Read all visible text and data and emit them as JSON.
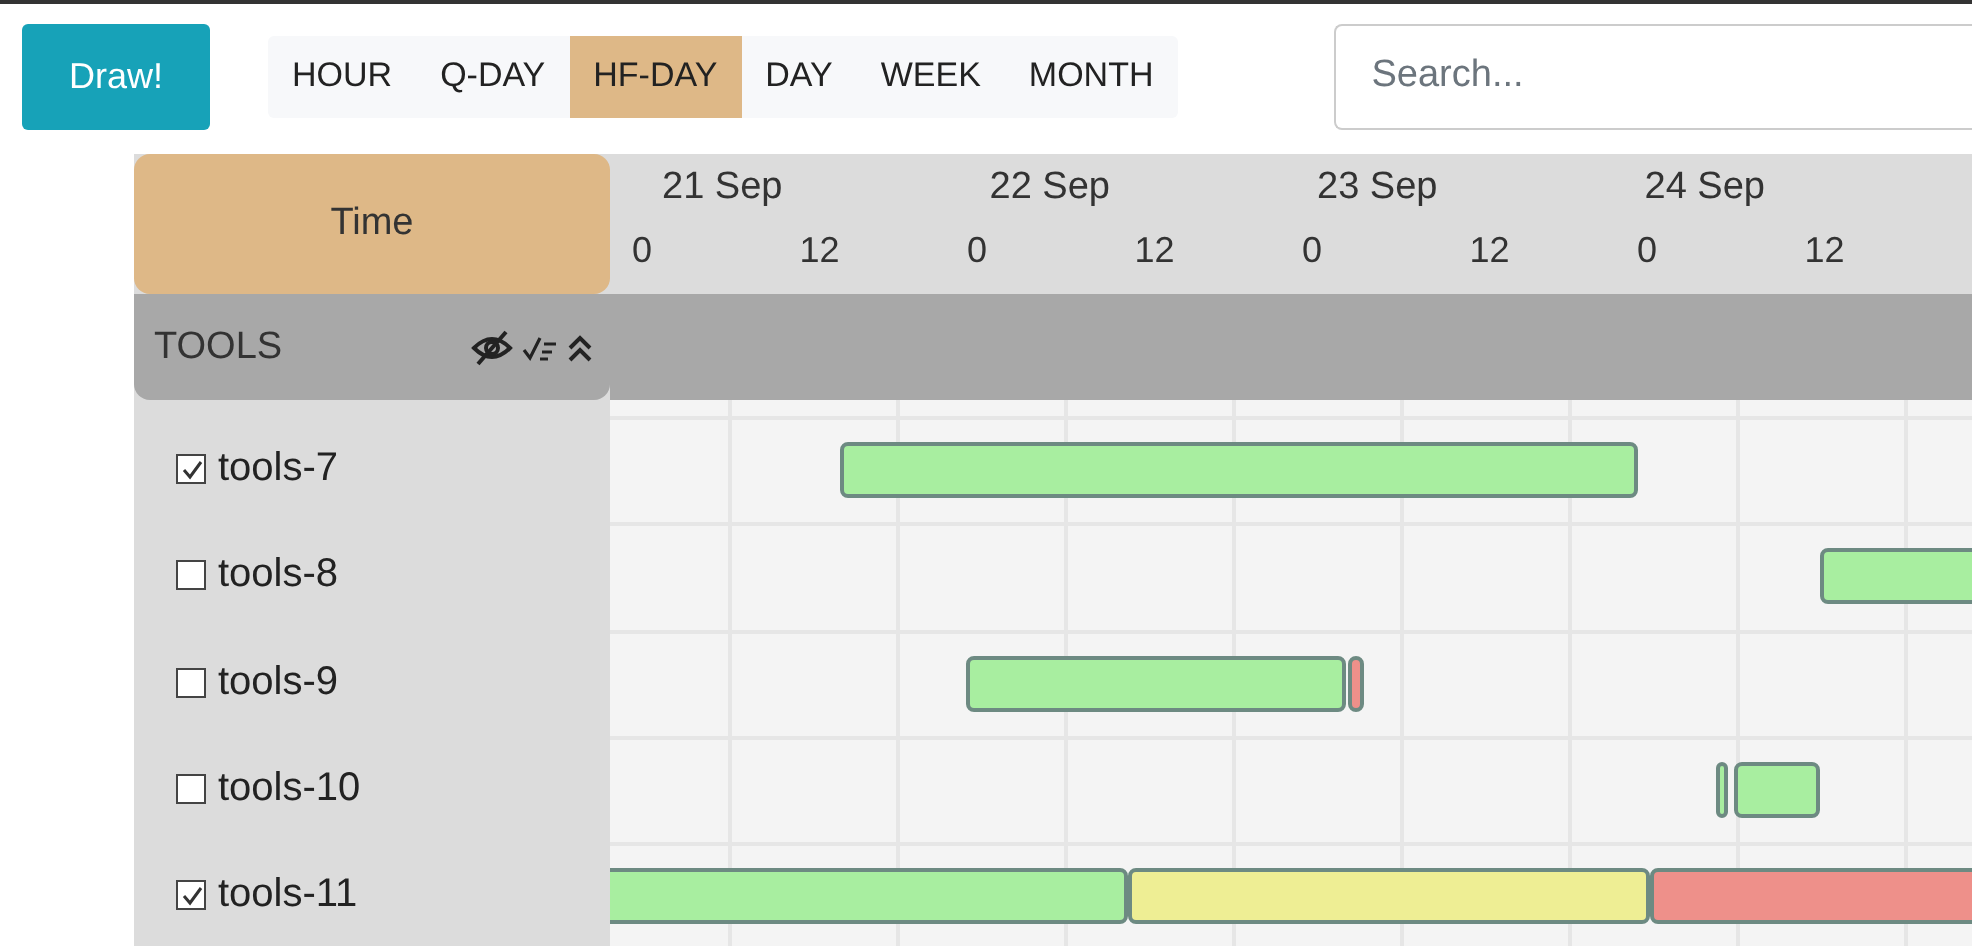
{
  "toolbar": {
    "draw_button": "Draw!",
    "scales": [
      {
        "label": "HOUR",
        "selected": false
      },
      {
        "label": "Q-DAY",
        "selected": false
      },
      {
        "label": "HF-DAY",
        "selected": true
      },
      {
        "label": "DAY",
        "selected": false
      },
      {
        "label": "WEEK",
        "selected": false
      },
      {
        "label": "MONTH",
        "selected": false
      }
    ],
    "search": {
      "placeholder": "Search..."
    }
  },
  "gantt": {
    "time_header": "Time",
    "days": [
      "21 Sep",
      "22 Sep",
      "23 Sep",
      "24 Sep"
    ],
    "hours": [
      "0",
      "12",
      "0",
      "12",
      "0",
      "12",
      "0",
      "12"
    ],
    "group": {
      "label": "TOOLS"
    },
    "rows": [
      {
        "label": "tools-7",
        "checked": true,
        "bars": [
          {
            "color": "#a8eea0"
          }
        ]
      },
      {
        "label": "tools-8",
        "checked": false,
        "bars": [
          {
            "color": "#a8eea0"
          }
        ]
      },
      {
        "label": "tools-9",
        "checked": false,
        "bars": [
          {
            "color": "#a8eea0"
          },
          {
            "color": "#ee908a"
          }
        ]
      },
      {
        "label": "tools-10",
        "checked": false,
        "bars": [
          {
            "color": "#a8eea0"
          },
          {
            "color": "#a8eea0"
          }
        ]
      },
      {
        "label": "tools-11",
        "checked": true,
        "bars": [
          {
            "color": "#a8eea0"
          },
          {
            "color": "#eeee94"
          },
          {
            "color": "#ee908a"
          }
        ]
      }
    ]
  }
}
